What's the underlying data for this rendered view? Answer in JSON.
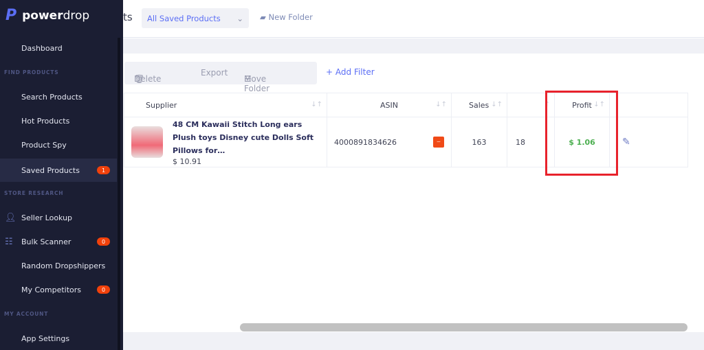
{
  "brand": {
    "logo_mark": "P",
    "name_bold": "power",
    "name_light": "drop"
  },
  "sidebar": {
    "dashboard": "Dashboard",
    "sections": [
      "FIND PRODUCTS",
      "STORE RESEARCH",
      "MY ACCOUNT"
    ],
    "items": [
      {
        "label": "Search Products"
      },
      {
        "label": "Hot Products"
      },
      {
        "label": "Product Spy"
      },
      {
        "label": "Saved Products",
        "badge": "1",
        "active": true
      },
      {
        "label": "Seller Lookup",
        "icon": "user-icon"
      },
      {
        "label": "Bulk Scanner",
        "badge": "0",
        "icon": "scanner-icon"
      },
      {
        "label": "Random Dropshippers"
      },
      {
        "label": "My Competitors",
        "badge": "0"
      },
      {
        "label": "App Settings"
      }
    ]
  },
  "header": {
    "title_partial": "ts",
    "folder_select": "All Saved Products",
    "new_folder": "New Folder"
  },
  "toolbar": {
    "delete": "Delete",
    "export": "Export",
    "move_folder": "Move Folder",
    "add_filter": "Add Filter"
  },
  "table": {
    "columns": [
      "Supplier",
      "ASIN",
      "Sales",
      "",
      "Profit",
      ""
    ],
    "rows": [
      {
        "name": "48 CM Kawaii Stitch Long ears Plush toys Disney cute Dolls Soft Pillows for…",
        "price": "$ 10.91",
        "asin": "4000891834626",
        "sales": "163",
        "col4": "18",
        "profit": "$ 1.06"
      }
    ]
  },
  "colors": {
    "accent": "#5b6ef5",
    "sidebar": "#1b1e33",
    "badge": "#f1410b",
    "profit": "#4caf50",
    "highlight": "#e8222b"
  }
}
